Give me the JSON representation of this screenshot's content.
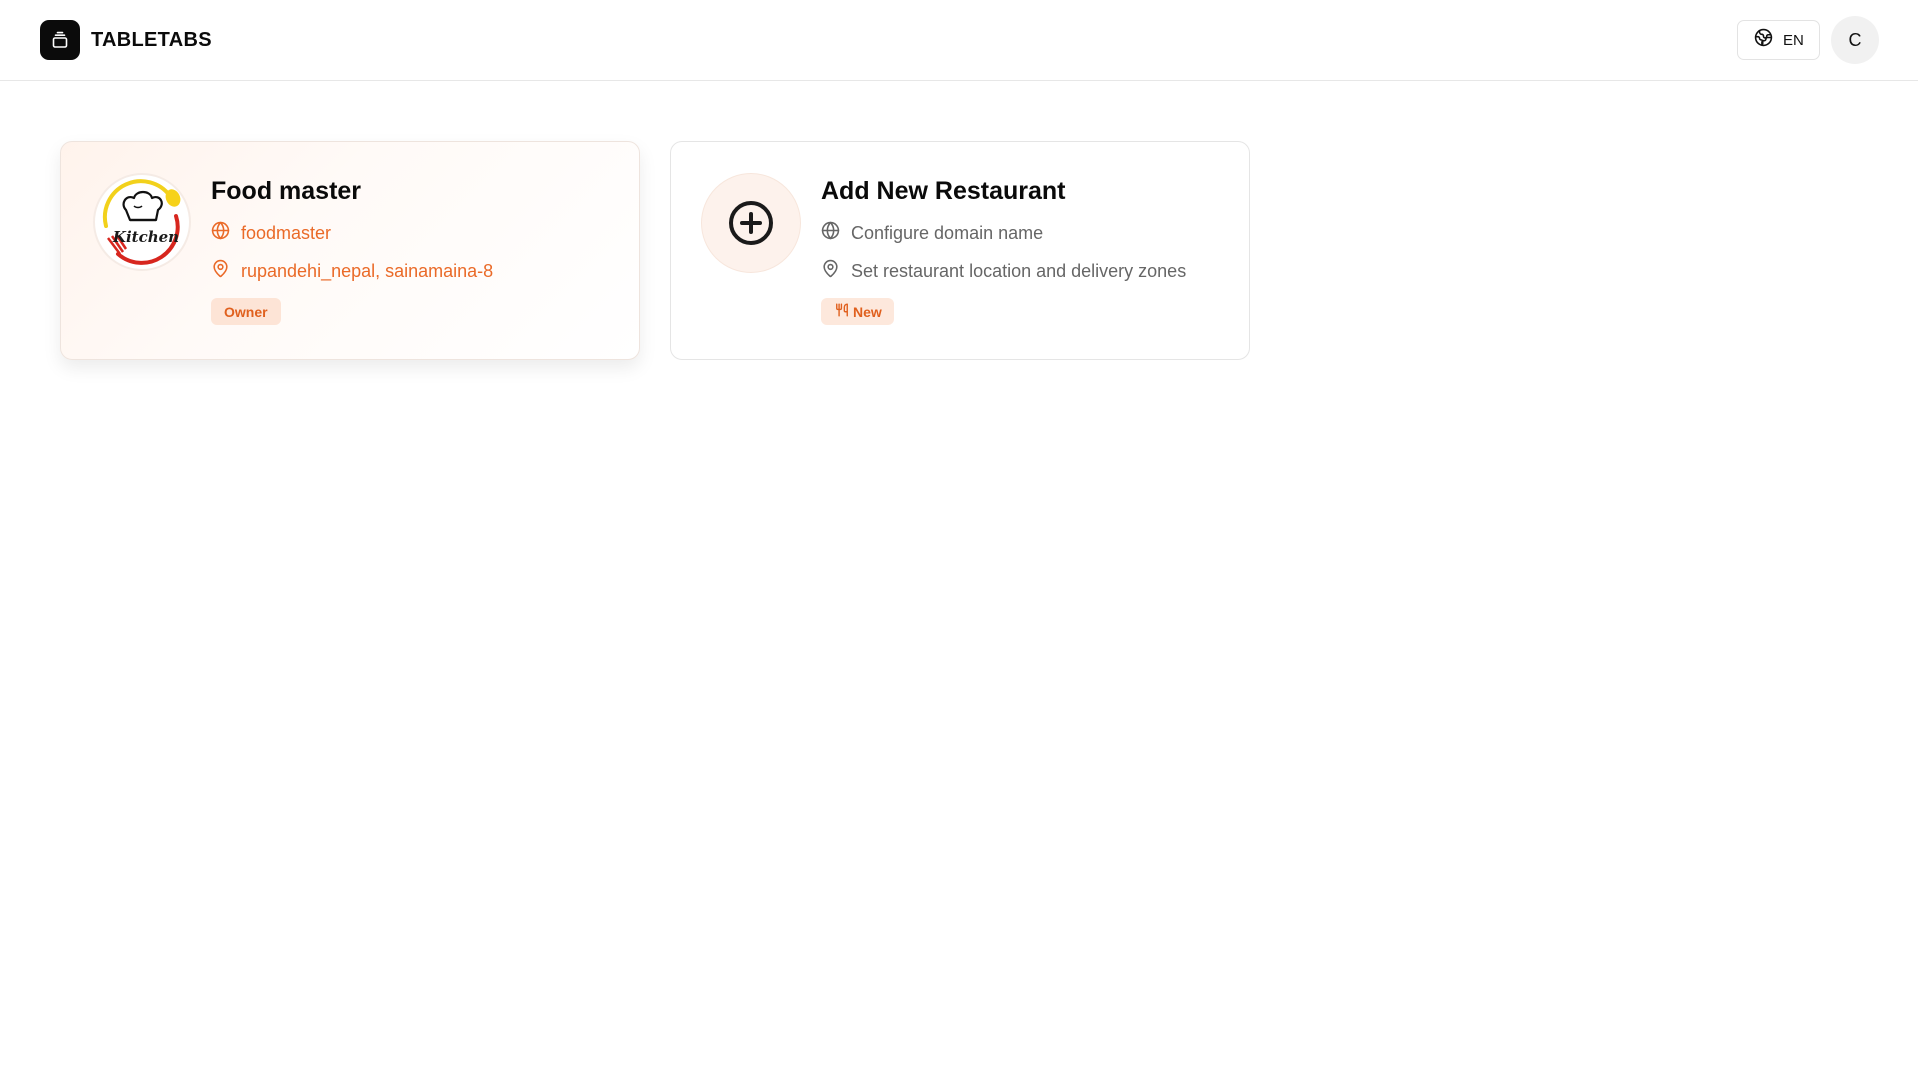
{
  "header": {
    "brand_name": "TABLETABS",
    "language_code": "EN",
    "user_initial": "C"
  },
  "restaurants": [
    {
      "name": "Food master",
      "domain": "foodmaster",
      "location": "rupandehi_nepal, sainamaina-8",
      "role_badge": "Owner",
      "logo_text": "Kitchen"
    }
  ],
  "add_card": {
    "title": "Add New Restaurant",
    "domain_hint": "Configure domain name",
    "location_hint": "Set restaurant location and delivery zones",
    "badge": "New"
  },
  "colors": {
    "accent": "#ea6a28",
    "badge_bg": "#fde4d6",
    "muted_text": "#666666"
  }
}
